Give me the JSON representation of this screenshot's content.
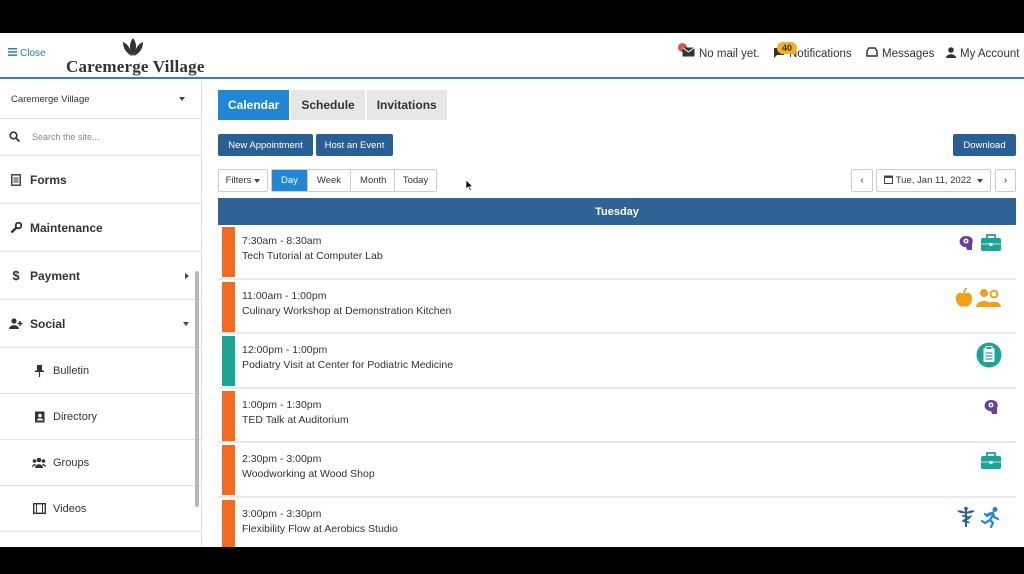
{
  "header": {
    "close_label": "Close",
    "logo_text": "Caremerge Village",
    "mail_label": "No mail yet.",
    "notifications_label": "Notifications",
    "notifications_count": "40",
    "messages_label": "Messages",
    "account_label": "My Account"
  },
  "sidebar": {
    "community": "Caremerge Village",
    "search_placeholder": "Search the site...",
    "items": [
      {
        "label": "Forms",
        "icon": "document-icon"
      },
      {
        "label": "Maintenance",
        "icon": "wrench-icon"
      },
      {
        "label": "Payment",
        "icon": "dollar-icon"
      },
      {
        "label": "Social",
        "icon": "add-user-icon"
      }
    ],
    "sub_items": [
      {
        "label": "Bulletin",
        "icon": "pin-icon"
      },
      {
        "label": "Directory",
        "icon": "address-book-icon"
      },
      {
        "label": "Groups",
        "icon": "group-icon"
      },
      {
        "label": "Videos",
        "icon": "film-icon"
      }
    ]
  },
  "tabs": [
    "Calendar",
    "Schedule",
    "Invitations"
  ],
  "toolbar": {
    "new_appointment": "New Appointment",
    "host_event": "Host an Event",
    "download": "Download",
    "filters": "Filters",
    "views": [
      "Day",
      "Week",
      "Month"
    ],
    "today": "Today",
    "date": "Tue, Jan 11, 2022"
  },
  "day_label": "Tuesday",
  "colors": {
    "orange": "#f26b21",
    "teal": "#1aa597",
    "purple": "#6b3fa0",
    "blue": "#1f87d6"
  },
  "events": [
    {
      "time": "7:30am - 8:30am",
      "title": "Tech Tutorial at Computer Lab",
      "color": "#f26b21",
      "icons": [
        "brain-icon",
        "briefcase-icon"
      ]
    },
    {
      "time": "11:00am - 1:00pm",
      "title": "Culinary Workshop at Demonstration Kitchen",
      "color": "#f26b21",
      "icons": [
        "apple-icon",
        "people-icon"
      ]
    },
    {
      "time": "12:00pm - 1:00pm",
      "title": "Podiatry Visit at Center for Podiatric Medicine",
      "color": "#1aa597",
      "icons": [
        "clipboard-icon"
      ]
    },
    {
      "time": "1:00pm - 1:30pm",
      "title": "TED Talk at Auditorium",
      "color": "#f26b21",
      "icons": [
        "brain-icon"
      ]
    },
    {
      "time": "2:30pm - 3:00pm",
      "title": "Woodworking at Wood Shop",
      "color": "#f26b21",
      "icons": [
        "briefcase-icon"
      ]
    },
    {
      "time": "3:00pm - 3:30pm",
      "title": "Flexibility Flow at Aerobics Studio",
      "color": "#f26b21",
      "icons": [
        "caduceus-icon",
        "running-icon"
      ]
    }
  ]
}
